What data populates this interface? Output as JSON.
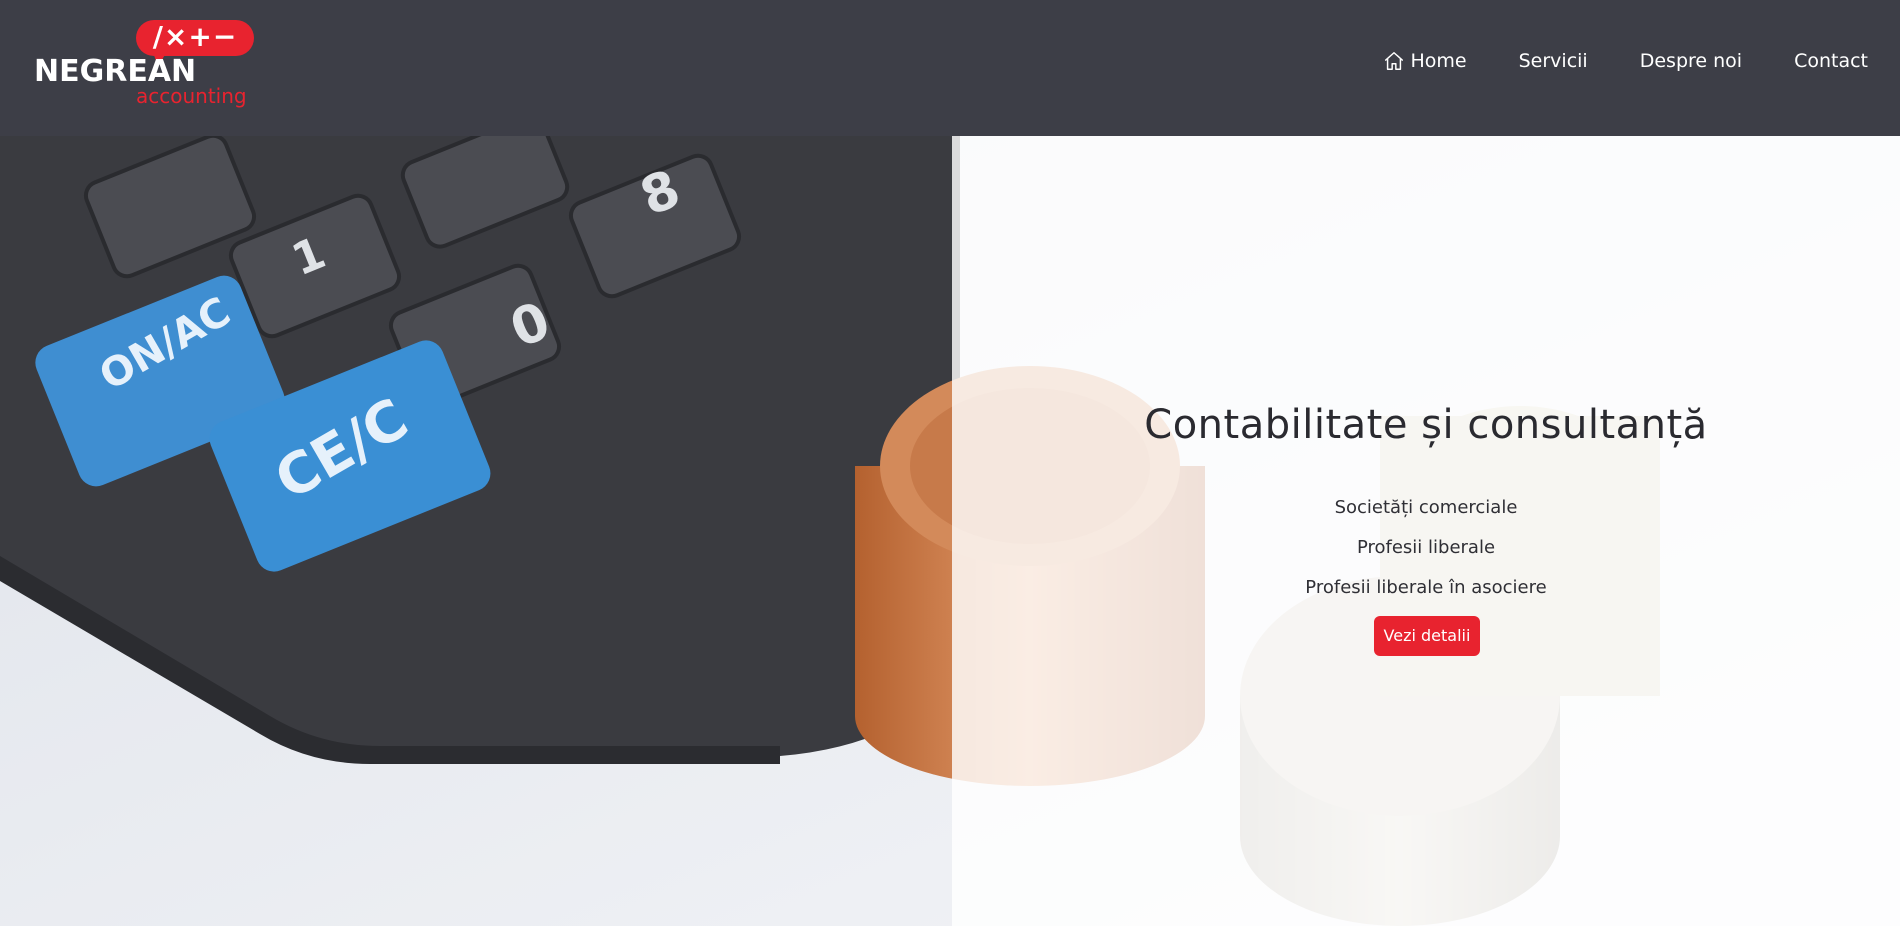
{
  "logo": {
    "operators": "/×+−",
    "name": "NEGREAN",
    "subtitle": "accounting"
  },
  "nav": {
    "items": [
      {
        "label": "Home",
        "icon": "home-icon"
      },
      {
        "label": "Servicii"
      },
      {
        "label": "Despre noi"
      },
      {
        "label": "Contact"
      }
    ]
  },
  "hero": {
    "headline": "Contabilitate și consultanță",
    "services": [
      "Societăți comerciale",
      "Profesii liberale",
      "Profesii liberale în asociere"
    ],
    "button_label": "Vezi detalii",
    "background_image": "calculator-and-coins-photo"
  },
  "colors": {
    "header": "#3d3e47",
    "accent": "#e8232f",
    "text": "#2a2a30"
  }
}
